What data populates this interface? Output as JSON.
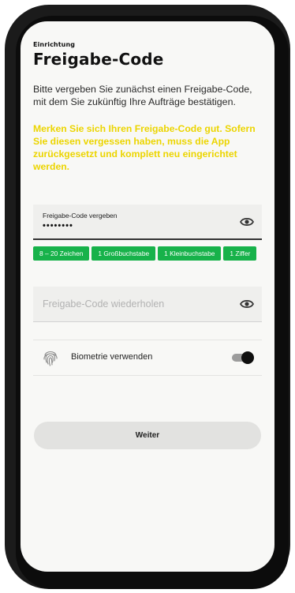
{
  "header": {
    "overline": "Einrichtung",
    "title": "Freigabe-Code"
  },
  "intro_text": "Bitte vergeben Sie zunächst einen Freigabe-Code, mit dem Sie zukünftig Ihre Aufträge bestätigen.",
  "warning_text": "Merken Sie sich Ihren Freigabe-Code gut. Sofern Sie diesen vergessen haben, muss die App zurückgesetzt und komplett neu eingerichtet werden.",
  "code_field": {
    "label": "Freigabe-Code vergeben",
    "value": "••••••••",
    "visibility_icon": "eye-icon"
  },
  "requirements": [
    "8 – 20 Zeichen",
    "1 Großbuchstabe",
    "1 Kleinbuchstabe",
    "1 Ziffer"
  ],
  "repeat_field": {
    "placeholder": "Freigabe-Code wiederholen",
    "value": "",
    "visibility_icon": "eye-icon"
  },
  "biometrics": {
    "label": "Biometrie verwenden",
    "enabled": true,
    "icon": "fingerprint-icon"
  },
  "continue_button": {
    "label": "Weiter"
  },
  "colors": {
    "warning": "#ecd500",
    "chip_bg": "#17b24a",
    "field_bg": "#efefed",
    "screen_bg": "#f8f8f6",
    "button_bg": "#e2e2e0"
  }
}
